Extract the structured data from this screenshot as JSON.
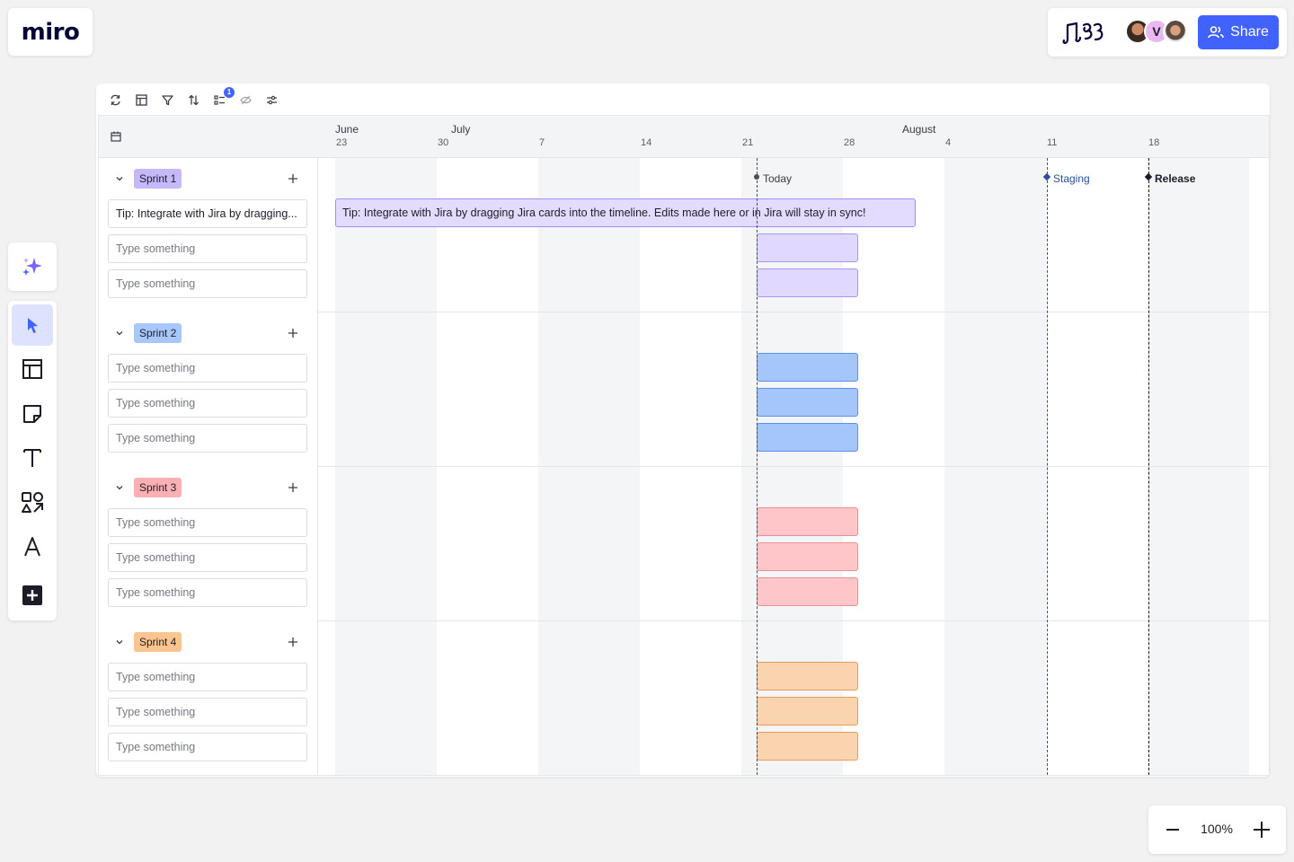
{
  "app": {
    "logo": "miro"
  },
  "header": {
    "share_label": "Share",
    "collaborators": [
      "avatar-1",
      "V",
      "avatar-3"
    ]
  },
  "zoom": {
    "level": "100%"
  },
  "left_toolbar": {
    "ai_icon": "sparkle-icon",
    "tools": [
      "select-cursor-icon",
      "templates-icon",
      "sticky-note-icon",
      "text-icon",
      "shapes-icon",
      "pen-icon",
      "add-icon"
    ]
  },
  "timeline": {
    "toolbar_badge": "1",
    "months": [
      "June",
      "July",
      "August"
    ],
    "days": [
      "23",
      "30",
      "7",
      "14",
      "21",
      "28",
      "4",
      "11",
      "18"
    ],
    "markers": [
      {
        "label": "Today",
        "color": "#383a44"
      },
      {
        "label": "Staging",
        "color": "#2c4f9e"
      },
      {
        "label": "Release",
        "color": "#1c1c28"
      }
    ],
    "tip_text": "Tip: Integrate with Jira by dragging Jira cards into the timeline. Edits made here or in Jira will stay in sync!",
    "sprints": [
      {
        "label": "Sprint 1",
        "tag_color": "#c7b7fb",
        "bar_color": "#e0d8ff",
        "bar_border": "#a895f8",
        "tasks": [
          {
            "value": "Tip: Integrate with Jira by dragging...",
            "placeholder": "Type something"
          },
          {
            "value": "",
            "placeholder": "Type something"
          },
          {
            "value": "",
            "placeholder": "Type something"
          }
        ]
      },
      {
        "label": "Sprint 2",
        "tag_color": "#a8c8fc",
        "bar_color": "#a4c6fb",
        "bar_border": "#5b8ff0",
        "tasks": [
          {
            "value": "",
            "placeholder": "Type something"
          },
          {
            "value": "",
            "placeholder": "Type something"
          },
          {
            "value": "",
            "placeholder": "Type something"
          }
        ]
      },
      {
        "label": "Sprint 3",
        "tag_color": "#fdb0b4",
        "bar_color": "#ffc6c9",
        "bar_border": "#ef8f95",
        "tasks": [
          {
            "value": "",
            "placeholder": "Type something"
          },
          {
            "value": "",
            "placeholder": "Type something"
          },
          {
            "value": "",
            "placeholder": "Type something"
          }
        ]
      },
      {
        "label": "Sprint 4",
        "tag_color": "#fcc48f",
        "bar_color": "#f9d4ae",
        "bar_border": "#e99a57",
        "tasks": [
          {
            "value": "",
            "placeholder": "Type something"
          },
          {
            "value": "",
            "placeholder": "Type something"
          },
          {
            "value": "",
            "placeholder": "Type something"
          }
        ]
      }
    ]
  }
}
